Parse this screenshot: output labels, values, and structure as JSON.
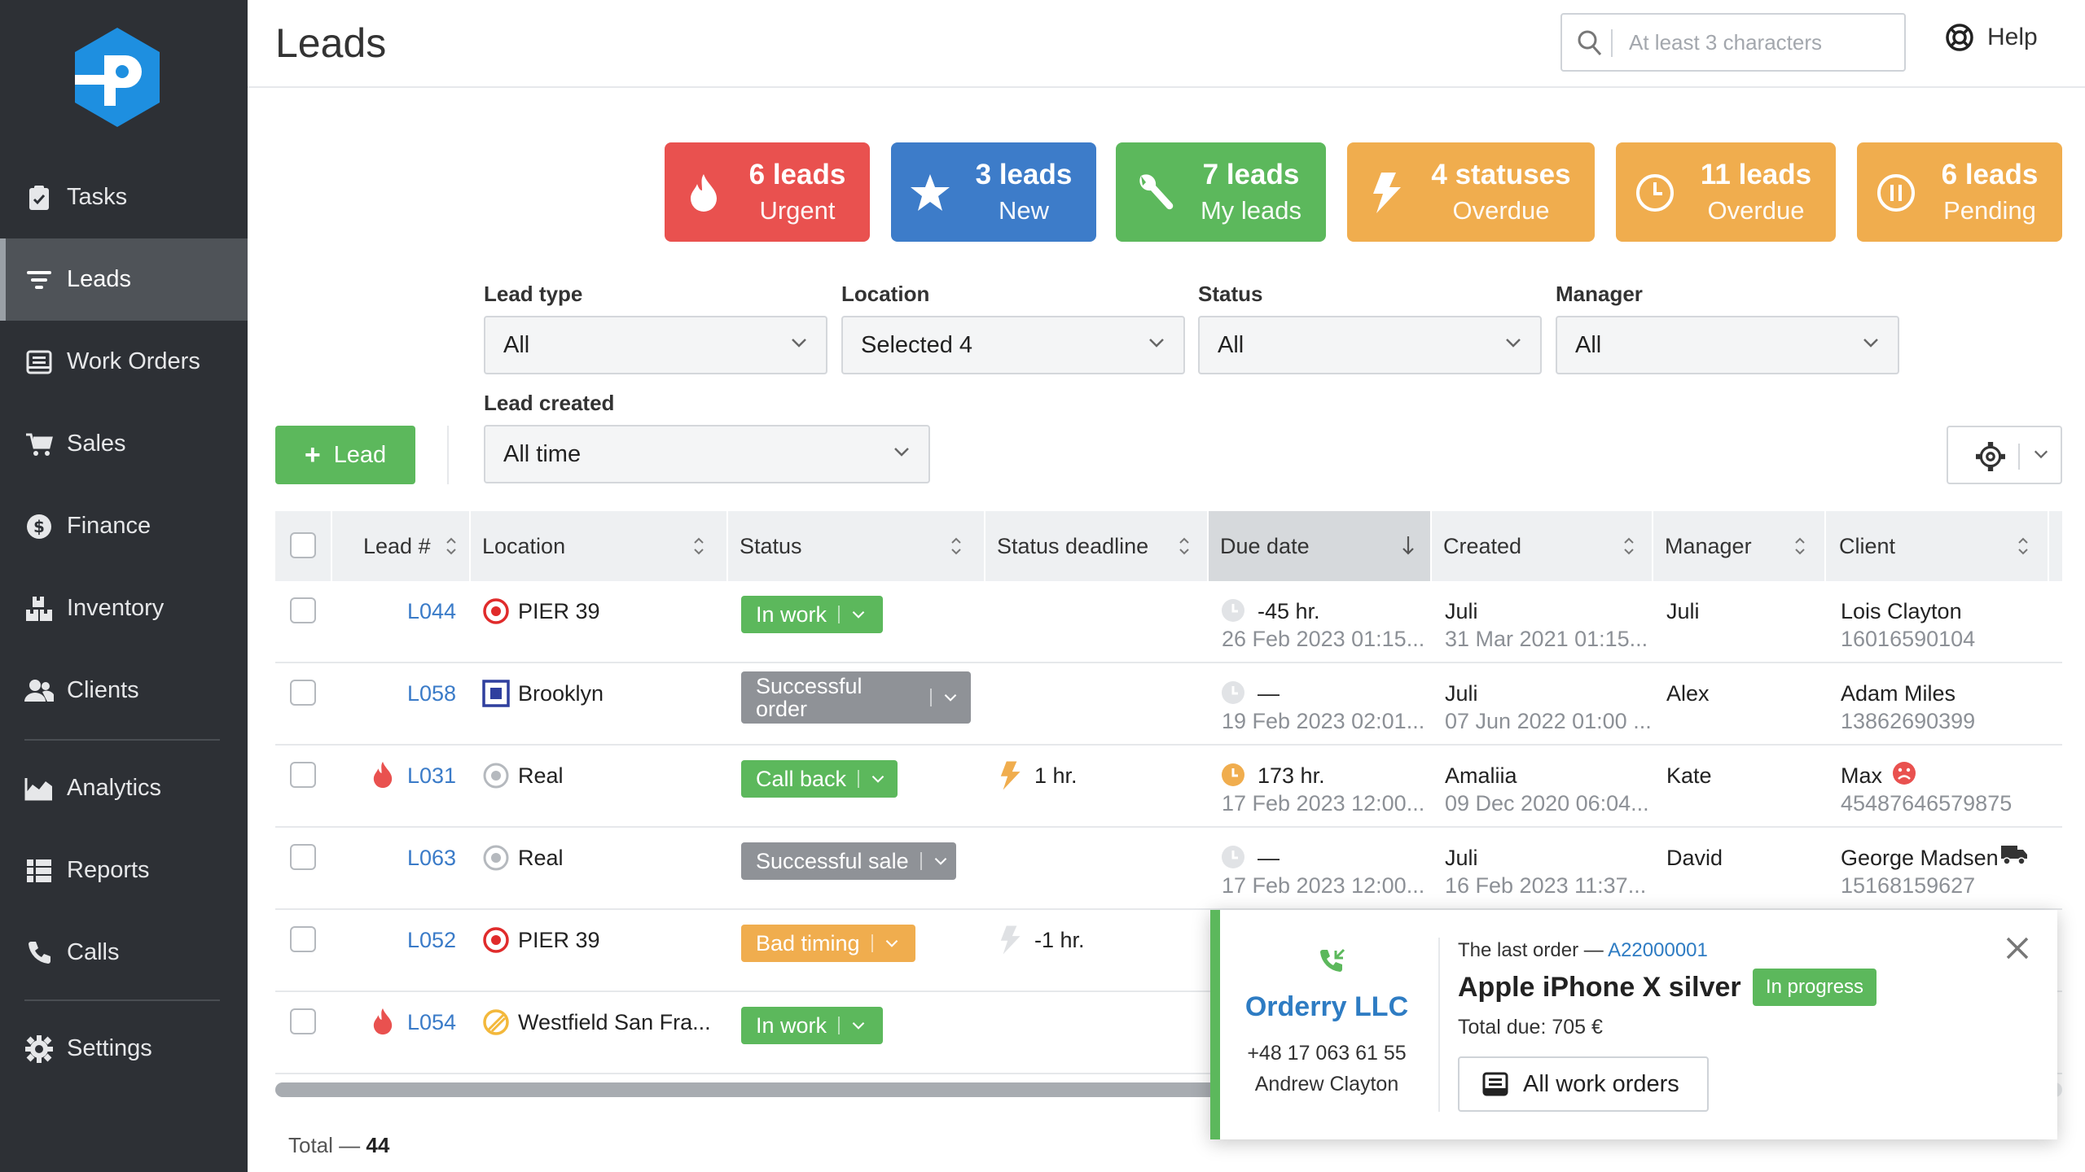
{
  "sidebar": {
    "items": [
      {
        "label": "Tasks",
        "icon": "clipboard-check-icon"
      },
      {
        "label": "Leads",
        "icon": "filter-icon",
        "active": true
      },
      {
        "label": "Work Orders",
        "icon": "inbox-icon"
      },
      {
        "label": "Sales",
        "icon": "cart-icon"
      },
      {
        "label": "Finance",
        "icon": "dollar-icon"
      },
      {
        "label": "Inventory",
        "icon": "boxes-icon"
      },
      {
        "label": "Clients",
        "icon": "users-icon"
      },
      {
        "label": "Analytics",
        "icon": "chart-area-icon"
      },
      {
        "label": "Reports",
        "icon": "list-icon"
      },
      {
        "label": "Calls",
        "icon": "phone-icon"
      },
      {
        "label": "Settings",
        "icon": "gear-icon"
      }
    ]
  },
  "header": {
    "title": "Leads",
    "search_placeholder": "At least 3 characters",
    "help_label": "Help"
  },
  "cards": [
    {
      "line1": "6 leads",
      "line2": "Urgent",
      "color": "#e9514f",
      "icon": "flame-icon"
    },
    {
      "line1": "3 leads",
      "line2": "New",
      "color": "#3d7cc9",
      "icon": "star-icon"
    },
    {
      "line1": "7 leads",
      "line2": "My leads",
      "color": "#5cb85c",
      "icon": "wrench-icon"
    },
    {
      "line1": "4 statuses",
      "line2": "Overdue",
      "color": "#f0ad4e",
      "icon": "lightning-icon"
    },
    {
      "line1": "11 leads",
      "line2": "Overdue",
      "color": "#f0ad4e",
      "icon": "clock-icon"
    },
    {
      "line1": "6 leads",
      "line2": "Pending",
      "color": "#f0ad4e",
      "icon": "pause-icon"
    }
  ],
  "filters": {
    "lead_type": {
      "label": "Lead type",
      "value": "All"
    },
    "location": {
      "label": "Location",
      "value": "Selected 4"
    },
    "status": {
      "label": "Status",
      "value": "All"
    },
    "manager": {
      "label": "Manager",
      "value": "All"
    },
    "lead_created": {
      "label": "Lead created",
      "value": "All time"
    }
  },
  "add_lead_label": "Lead",
  "table": {
    "columns": [
      "Lead #",
      "Location",
      "Status",
      "Status deadline",
      "Due date",
      "Created",
      "Manager",
      "Client"
    ],
    "rows": [
      {
        "urgent": false,
        "lead": "L044",
        "location": "PIER 39",
        "loc_icon": "target-icon",
        "status": "In work",
        "status_color": "#5cb85c",
        "deadline": "",
        "due": "-45 hr.",
        "due_date": "26 Feb 2023 01:15...",
        "created_by": "Juli",
        "created": "31 Mar 2021 01:15...",
        "manager": "Juli",
        "client": "Lois Clayton",
        "client_phone": "16016590104"
      },
      {
        "urgent": false,
        "lead": "L058",
        "location": "Brooklyn",
        "loc_icon": "square-icon",
        "status": "Successful order",
        "status_color": "#8f9297",
        "deadline": "",
        "due": "—",
        "due_date": "19 Feb 2023 02:01...",
        "created_by": "Juli",
        "created": "07 Jun 2022 01:00 ...",
        "manager": "Alex",
        "client": "Adam Miles",
        "client_phone": "13862690399"
      },
      {
        "urgent": true,
        "lead": "L031",
        "location": "Real",
        "loc_icon": "circle-icon",
        "status": "Call back",
        "status_color": "#5cb85c",
        "deadline": "1 hr.",
        "due": "173 hr.",
        "due_date": "17 Feb 2023 12:00...",
        "created_by": "Amaliia",
        "created": "09 Dec 2020 06:04...",
        "manager": "Kate",
        "client": "Max",
        "client_phone": "45487646579875"
      },
      {
        "urgent": false,
        "lead": "L063",
        "location": "Real",
        "loc_icon": "circle-icon",
        "status": "Successful sale",
        "status_color": "#8f9297",
        "deadline": "",
        "due": "—",
        "due_date": "17 Feb 2023 12:00...",
        "created_by": "Juli",
        "created": "16 Feb 2023 11:37...",
        "manager": "David",
        "client": "George Madsen",
        "client_phone": "15168159627"
      },
      {
        "urgent": false,
        "lead": "L052",
        "location": "PIER 39",
        "loc_icon": "target-icon",
        "status": "Bad timing",
        "status_color": "#f0ad4e",
        "deadline": "-1 hr.",
        "due": "",
        "due_date": "",
        "created_by": "",
        "created": "",
        "manager": "",
        "client": "",
        "client_phone": ""
      },
      {
        "urgent": true,
        "lead": "L054",
        "location": "Westfield San Fra...",
        "loc_icon": "ban-icon",
        "status": "In work",
        "status_color": "#5cb85c",
        "deadline": "",
        "due": "",
        "due_date": "",
        "created_by": "",
        "created": "",
        "manager": "",
        "client": "",
        "client_phone": ""
      }
    ]
  },
  "total_label": "Total —",
  "total_value": "44",
  "popup": {
    "company": "Orderry LLC",
    "phone": "+48 17 063 61 55",
    "person": "Andrew Clayton",
    "last_order_label": "The last order —",
    "last_order_id": "A22000001",
    "product": "Apple iPhone X silver",
    "badge": "In progress",
    "total_due": "Total due: 705 €",
    "button": "All work orders"
  }
}
